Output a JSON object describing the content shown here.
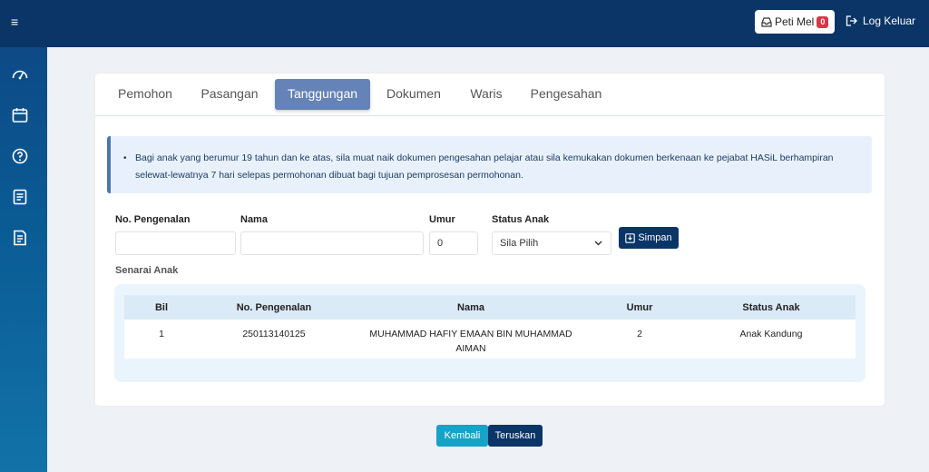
{
  "header": {
    "menu_icon": "≡",
    "peti_mel_label": "Peti Mel",
    "peti_mel_count": "0",
    "logout_label": "Log Keluar"
  },
  "sidebar": {
    "items": [
      {
        "icon": "dashboard-icon"
      },
      {
        "icon": "calendar-icon"
      },
      {
        "icon": "help-icon"
      },
      {
        "icon": "form-icon"
      },
      {
        "icon": "document-icon"
      }
    ]
  },
  "tabs": [
    {
      "label": "Pemohon"
    },
    {
      "label": "Pasangan"
    },
    {
      "label": "Tanggungan",
      "active": true
    },
    {
      "label": "Dokumen"
    },
    {
      "label": "Waris"
    },
    {
      "label": "Pengesahan"
    }
  ],
  "alert": {
    "text": "Bagi anak yang berumur 19 tahun dan ke atas, sila muat naik dokumen pengesahan pelajar atau sila kemukakan dokumen berkenaan ke pejabat HASiL berhampiran selewat-lewatnya 7 hari selepas permohonan dibuat bagi tujuan pemprosesan permohonan."
  },
  "form": {
    "no_pengenalan_label": "No. Pengenalan",
    "no_pengenalan_value": "",
    "nama_label": "Nama",
    "nama_value": "",
    "umur_label": "Umur",
    "umur_value": "0",
    "status_label": "Status Anak",
    "status_selected": "Sila Pilih",
    "save_label": "Simpan"
  },
  "list": {
    "title": "Senarai Anak",
    "columns": [
      "Bil",
      "No. Pengenalan",
      "Nama",
      "Umur",
      "Status Anak"
    ],
    "rows": [
      {
        "bil": "1",
        "no_pengenalan": "250113140125",
        "nama_line1": "MUHAMMAD HAFIY EMAAN BIN MUHAMMAD",
        "nama_line2": "AIMAN",
        "umur": "2",
        "status": "Anak Kandung"
      }
    ]
  },
  "footer": {
    "back_label": "Kembali",
    "next_label": "Teruskan"
  },
  "colors": {
    "navy": "#0b3566",
    "active_tab": "#6583b7",
    "cyan_button": "#17a2c8",
    "badge_red": "#dc3545"
  }
}
